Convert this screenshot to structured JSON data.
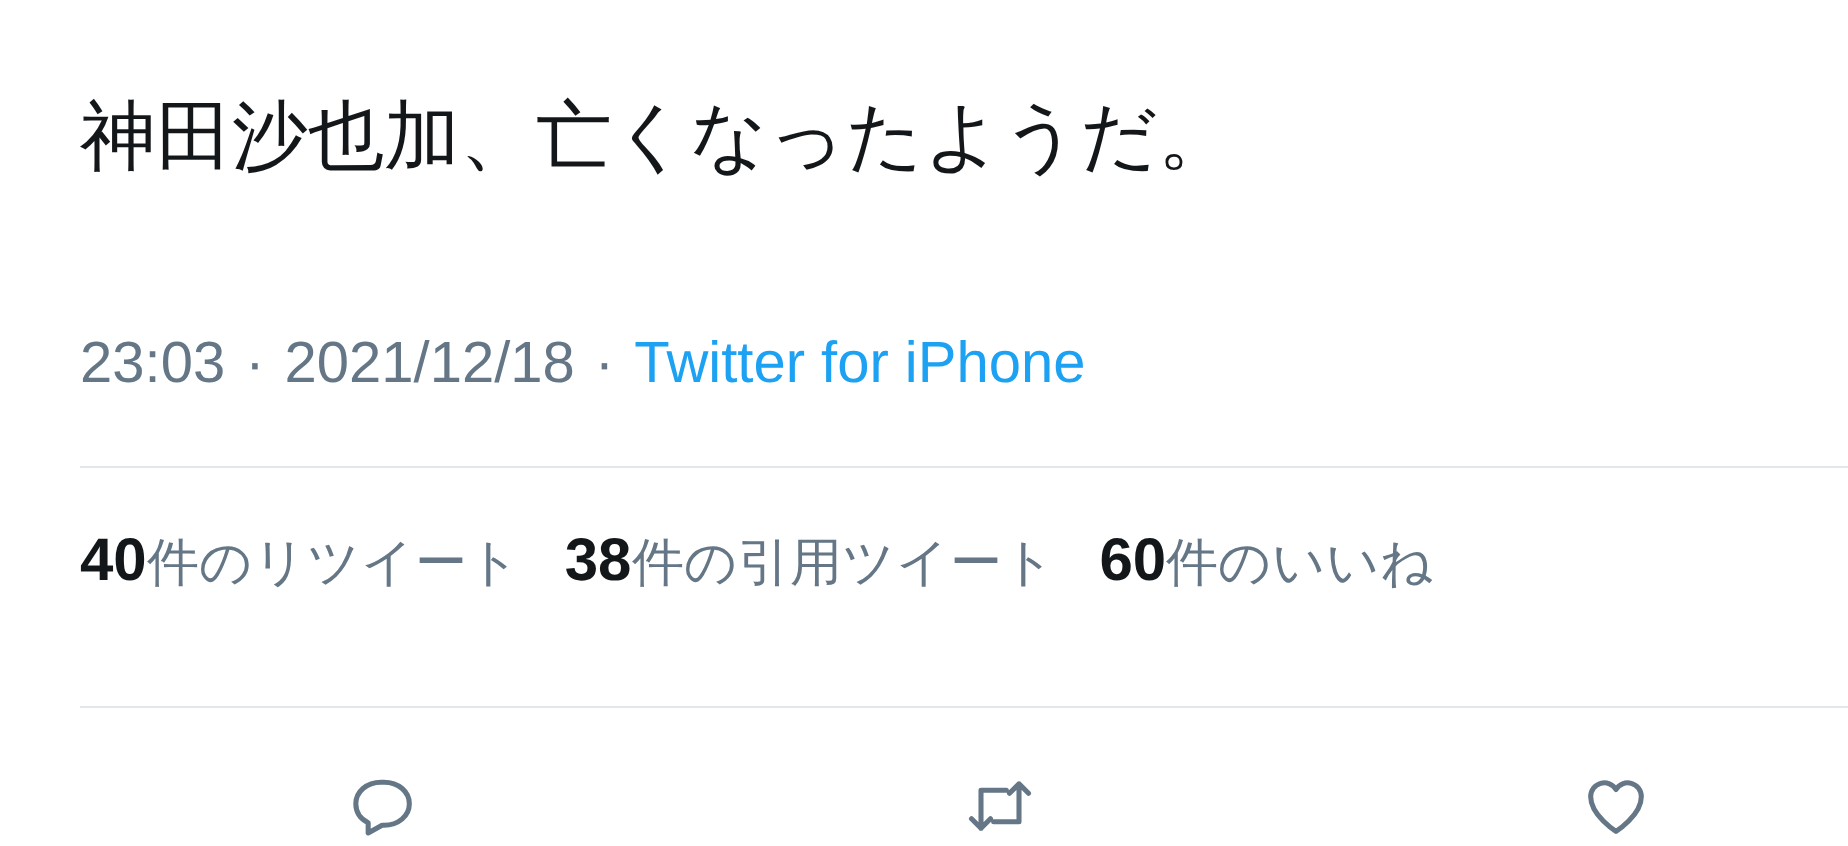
{
  "tweet": {
    "text": "神田沙也加、亡くなったようだ。",
    "time": "23:03",
    "date": "2021/12/18",
    "source": "Twitter for iPhone",
    "separators": [
      "·",
      "·"
    ]
  },
  "stats": [
    {
      "text": "**40**件のリツイート"
    },
    {
      "text": "**38**件の引用ツイート"
    },
    {
      "text": "**60**件のいいね"
    }
  ],
  "actions": [
    {
      "kind": "reply"
    },
    {
      "kind": "retweet"
    },
    {
      "kind": "like"
    }
  ]
}
